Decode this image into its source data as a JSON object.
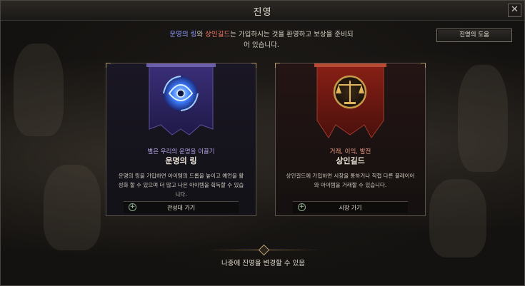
{
  "window": {
    "title": "진영",
    "close_label": "✕"
  },
  "welcome": {
    "ring_name": "운명의 링",
    "conj_1": "와 ",
    "guild_name": "상인길드",
    "rest_line1": "는 가입하시는 것을 환영하고 보상을 준비되",
    "line2": "어 있습니다."
  },
  "guide_button": {
    "label": "진영의 도움"
  },
  "factions": [
    {
      "subtitle": "별은 우리의 운명을 이끌기",
      "name": "운명의 링",
      "description": "운명의 링을 가입하면 아이템의 드롭을 높이고 예언을 활성화 할 수 있으며 더 많고 나은 아이템을 획득할 수 있습니다.",
      "action_label": "관성대 가기",
      "accent": "#8e9bff"
    },
    {
      "subtitle": "거래, 이익, 발전",
      "name": "상인길드",
      "description": "상인길드에 가입하면 시장을 통하거나 직접 다른 플레이어와 아이템을 거래할 수 있습니다.",
      "action_label": "시장 가기",
      "accent": "#ff7a6a"
    }
  ],
  "footer": {
    "note": "나중에 진영을 변경할 수 있음"
  }
}
